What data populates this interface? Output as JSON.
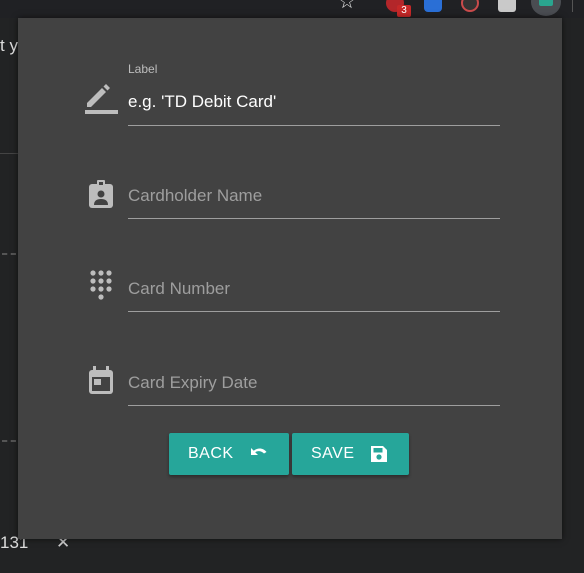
{
  "background": {
    "fragment_top": "t y",
    "fragment_bottom": "131",
    "close_glyph": "✕"
  },
  "toolbar": {
    "star_icon": "star-icon",
    "badge_count": "3"
  },
  "form": {
    "label_field": {
      "floating_label": "Label",
      "placeholder": "e.g. 'TD Debit Card'",
      "icon": "pencil-icon"
    },
    "cardholder_field": {
      "placeholder": "Cardholder Name",
      "icon": "contact-card-icon"
    },
    "card_number_field": {
      "placeholder": "Card Number",
      "icon": "dialpad-icon"
    },
    "expiry_field": {
      "placeholder": "Card Expiry Date",
      "icon": "calendar-icon"
    }
  },
  "buttons": {
    "back_label": "BACK",
    "save_label": "SAVE",
    "back_icon": "undo-icon",
    "save_icon": "floppy-disk-icon"
  },
  "colors": {
    "popup_bg": "#424242",
    "accent": "#26a69a",
    "underline": "#9e9e9e"
  }
}
